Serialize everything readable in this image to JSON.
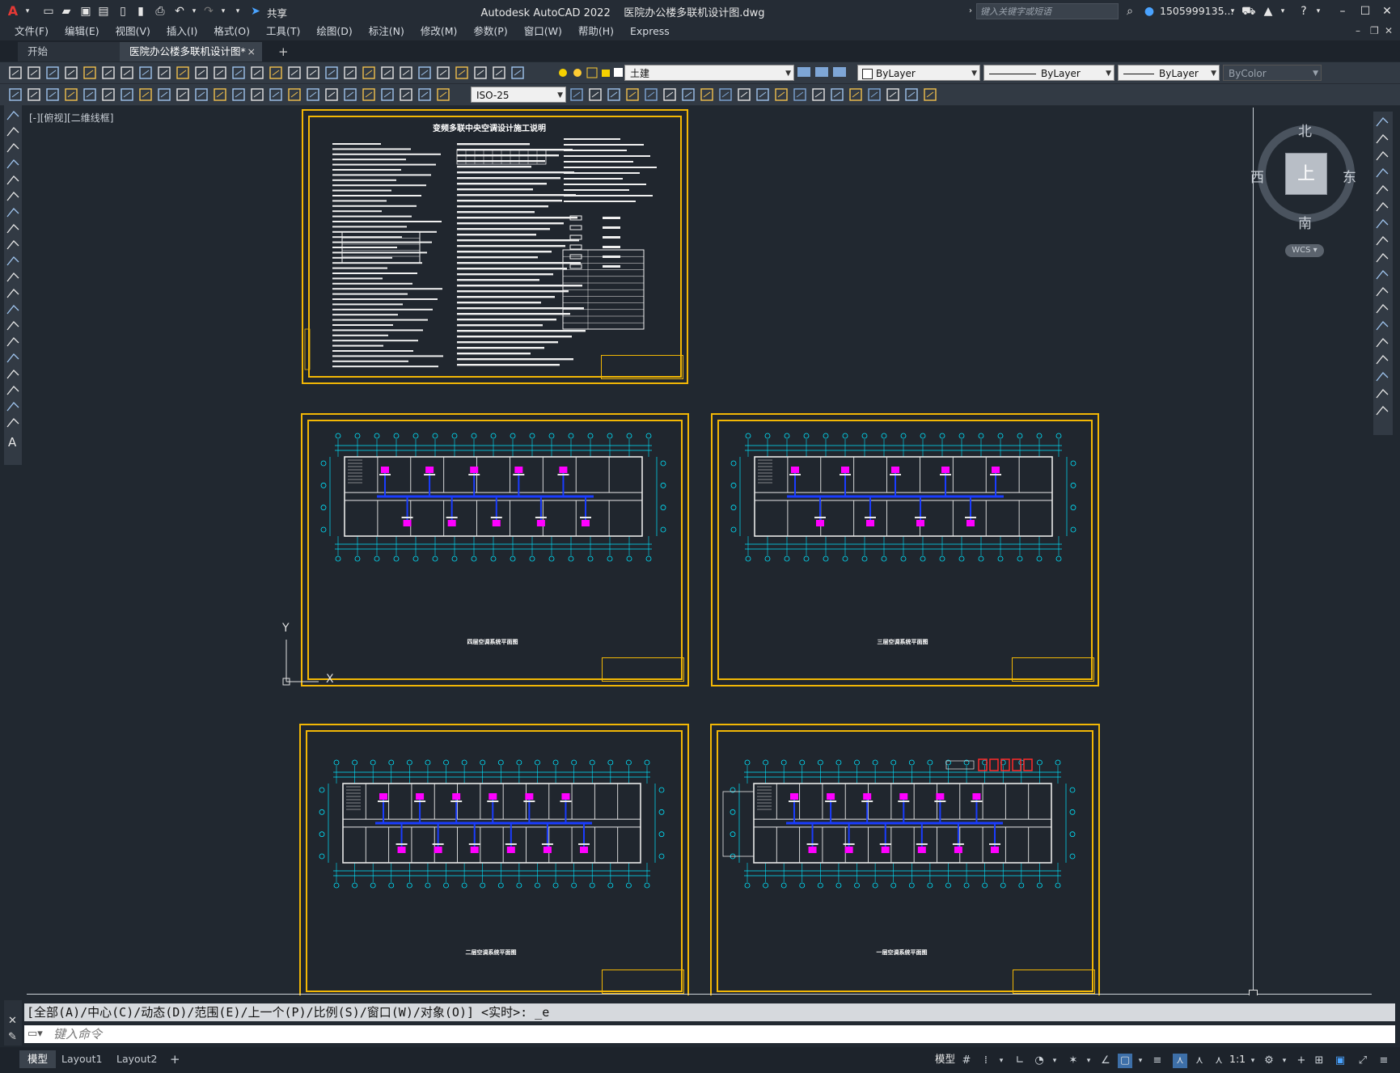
{
  "window": {
    "app_title": "Autodesk AutoCAD 2022",
    "file_title": "医院办公楼多联机设计图.dwg",
    "search_placeholder": "键入关键字或短语",
    "user": "1505999135...",
    "share_label": "共享"
  },
  "menu": [
    "文件(F)",
    "编辑(E)",
    "视图(V)",
    "插入(I)",
    "格式(O)",
    "工具(T)",
    "绘图(D)",
    "标注(N)",
    "修改(M)",
    "参数(P)",
    "窗口(W)",
    "帮助(H)",
    "Express"
  ],
  "doc_tabs": {
    "start": "开始",
    "active": "医院办公楼多联机设计图*",
    "close": "×",
    "add": "+"
  },
  "toolbar": {
    "layer_value": "土建",
    "color_value": "ByLayer",
    "linetype_value": "ByLayer",
    "lineweight_value": "ByLayer",
    "plotstyle_value": "ByColor",
    "dimstyle_value": "ISO-25"
  },
  "viewport": {
    "label": "[-][俯视][二维线框]",
    "ucs_x": "X",
    "ucs_y": "Y"
  },
  "sheets": {
    "notes_title": "变频多联中央空调设计施工说明",
    "plan4_title": "四层空调系统平面图",
    "plan3_title": "三层空调系统平面图",
    "plan2_title": "二层空调系统平面图",
    "plan1_title": "一层空调系统平面图"
  },
  "viewcube": {
    "north": "北",
    "south": "南",
    "east": "东",
    "west": "西",
    "face": "上",
    "wcs": "WCS"
  },
  "command": {
    "history": "[全部(A)/中心(C)/动态(D)/范围(E)/上一个(P)/比例(S)/窗口(W)/对象(O)] <实时>: _e",
    "placeholder": "键入命令"
  },
  "layout_tabs": [
    "模型",
    "Layout1",
    "Layout2"
  ],
  "layout_add": "+",
  "status": {
    "model": "模型",
    "scale": "1:1"
  },
  "colors": {
    "sheet_border": "#f2b705",
    "axis_cyan": "#00e5ff",
    "duct_blue": "#1a3cff",
    "unit_magenta": "#ff00ff",
    "background": "#212830"
  }
}
